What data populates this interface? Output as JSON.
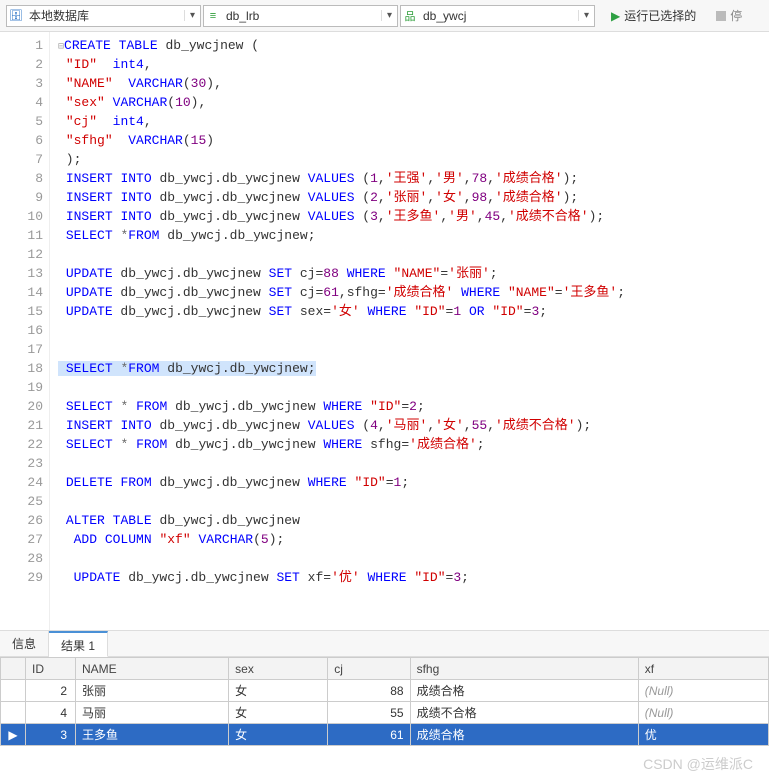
{
  "toolbar": {
    "combo1": {
      "label": "本地数据库"
    },
    "combo2": {
      "label": "db_lrb"
    },
    "combo3": {
      "label": "db_ywcj"
    },
    "run_label": "运行已选择的",
    "stop_label": "停"
  },
  "code_lines": [
    "CREATE TABLE db_ywcjnew (",
    " \"ID\"  int4,",
    " \"NAME\"  VARCHAR(30),",
    " \"sex\" VARCHAR(10),",
    " \"cj\"  int4,",
    " \"sfhg\"  VARCHAR(15)",
    " );",
    " INSERT INTO db_ywcj.db_ywcjnew VALUES (1,'王强','男',78,'成绩合格');",
    " INSERT INTO db_ywcj.db_ywcjnew VALUES (2,'张丽','女',98,'成绩合格');",
    " INSERT INTO db_ywcj.db_ywcjnew VALUES (3,'王多鱼','男',45,'成绩不合格');",
    " SELECT *FROM db_ywcj.db_ywcjnew;",
    "",
    " UPDATE db_ywcj.db_ywcjnew SET cj=88 WHERE \"NAME\"='张丽';",
    " UPDATE db_ywcj.db_ywcjnew SET cj=61,sfhg='成绩合格' WHERE \"NAME\"='王多鱼';",
    " UPDATE db_ywcj.db_ywcjnew SET sex='女' WHERE \"ID\"=1 OR \"ID\"=3;",
    "",
    "",
    " SELECT *FROM db_ywcj.db_ywcjnew;",
    "",
    " SELECT * FROM db_ywcj.db_ywcjnew WHERE \"ID\"=2;",
    " INSERT INTO db_ywcj.db_ywcjnew VALUES (4,'马丽','女',55,'成绩不合格');",
    " SELECT * FROM db_ywcj.db_ywcjnew WHERE sfhg='成绩合格';",
    "",
    " DELETE FROM db_ywcj.db_ywcjnew WHERE \"ID\"=1;",
    "",
    " ALTER TABLE db_ywcj.db_ywcjnew",
    "  ADD COLUMN \"xf\" VARCHAR(5);",
    "",
    "  UPDATE db_ywcj.db_ywcjnew SET xf='优' WHERE \"ID\"=3;"
  ],
  "tabs": {
    "info": "信息",
    "result": "结果 1"
  },
  "columns": [
    "ID",
    "NAME",
    "sex",
    "cj",
    "sfhg",
    "xf"
  ],
  "rows": [
    {
      "mark": "",
      "id": "2",
      "name": "张丽",
      "sex": "女",
      "cj": "88",
      "sfhg": "成绩合格",
      "xf": "(Null)",
      "sel": false
    },
    {
      "mark": "",
      "id": "4",
      "name": "马丽",
      "sex": "女",
      "cj": "55",
      "sfhg": "成绩不合格",
      "xf": "(Null)",
      "sel": false
    },
    {
      "mark": "▶",
      "id": "3",
      "name": "王多鱼",
      "sex": "女",
      "cj": "61",
      "sfhg": "成绩合格",
      "xf": "优",
      "sel": true
    }
  ],
  "watermark": "CSDN @运维派C"
}
